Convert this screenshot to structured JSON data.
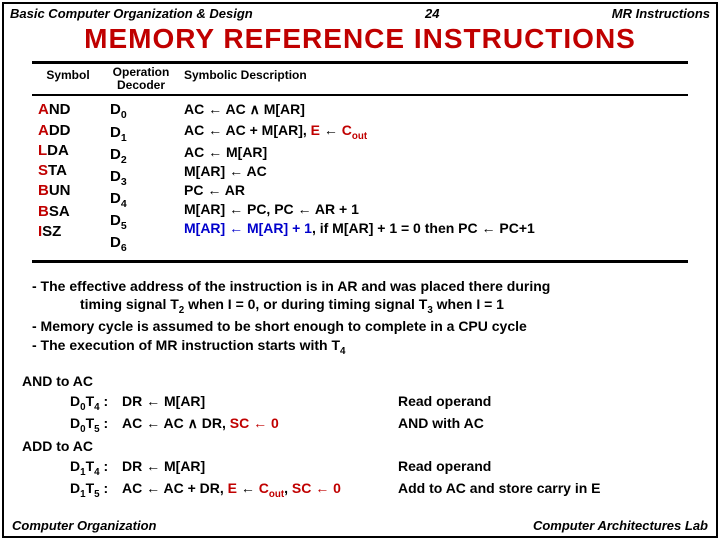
{
  "header": {
    "left": "Basic Computer Organization & Design",
    "mid": "24",
    "right": "MR Instructions"
  },
  "title": "MEMORY  REFERENCE  INSTRUCTIONS",
  "table": {
    "head": {
      "c1": "Symbol",
      "c2a": "Operation",
      "c2b": "Decoder",
      "c3": "Symbolic Description"
    },
    "rows": [
      {
        "sym": "AND",
        "symHtml": "<span class='red'>A</span>ND",
        "dec": "D",
        "decSub": "0",
        "descHtml": "AC ←  AC <span class='and-sym'>∧</span> M[AR]"
      },
      {
        "sym": "ADD",
        "symHtml": "<span class='red'>A</span>DD",
        "dec": "D",
        "decSub": "1",
        "descHtml": "AC ←  AC + M[AR], <span class='red'>E</span> ← <span class='red'>C<sub>out</sub></span>"
      },
      {
        "sym": "LDA",
        "symHtml": "<span class='red'>L</span>DA",
        "dec": "D",
        "decSub": "2",
        "descHtml": "AC ←  M[AR]"
      },
      {
        "sym": "STA",
        "symHtml": "<span class='red'>S</span>TA",
        "dec": "D",
        "decSub": "3",
        "descHtml": "M[AR] ←  AC"
      },
      {
        "sym": "BUN",
        "symHtml": "<span class='red'>B</span>UN",
        "dec": "D",
        "decSub": "4",
        "descHtml": "PC ←  AR"
      },
      {
        "sym": "BSA",
        "symHtml": "<span class='red'>B</span>SA",
        "dec": "D",
        "decSub": "5",
        "descHtml": "M[AR] ←  PC, PC ←  AR + 1"
      },
      {
        "sym": "ISZ",
        "symHtml": "<span class='red'>I</span>SZ",
        "dec": "D",
        "decSub": "6",
        "descHtml": "<span class='blue'>M[AR] ←  M[AR] + 1</span>, if M[AR] + 1 = 0 then PC ←  PC+1"
      }
    ]
  },
  "notes": {
    "l1": "- The effective address of the instruction is in AR and was placed there during",
    "l1bHtml": "timing signal T<sub>2</sub> when I = 0, or during timing signal T<sub>3</sub> when I = 1",
    "l2": "- Memory cycle is assumed to be short enough to complete in a CPU cycle",
    "l3Html": "- The execution of MR instruction starts with T<sub>4</sub>"
  },
  "ops": {
    "g1": {
      "title": "AND to AC",
      "r1": {
        "labHtml": "D<sub>0</sub>T<sub>4</sub> :",
        "exprHtml": "DR ← M[AR]",
        "cmt": "Read operand"
      },
      "r2": {
        "labHtml": "D<sub>0</sub>T<sub>5</sub> :",
        "exprHtml": "AC ← AC <span class='and-sym'>∧</span> DR, <span class='red'>SC ← 0</span>",
        "cmt": "AND with AC"
      }
    },
    "g2": {
      "title": "ADD to AC",
      "r1": {
        "labHtml": "D<sub>1</sub>T<sub>4</sub> :",
        "exprHtml": "DR ← M[AR]",
        "cmt": "Read operand"
      },
      "r2": {
        "labHtml": "D<sub>1</sub>T<sub>5</sub> :",
        "exprHtml": "AC ← AC + DR, <span class='red'>E</span> ← <span class='red'>C<sub>out</sub></span>, <span class='red'>SC ← 0</span>",
        "cmt": "Add to AC and store carry in E"
      }
    }
  },
  "footer": {
    "left": "Computer Organization",
    "right": "Computer Architectures Lab"
  }
}
